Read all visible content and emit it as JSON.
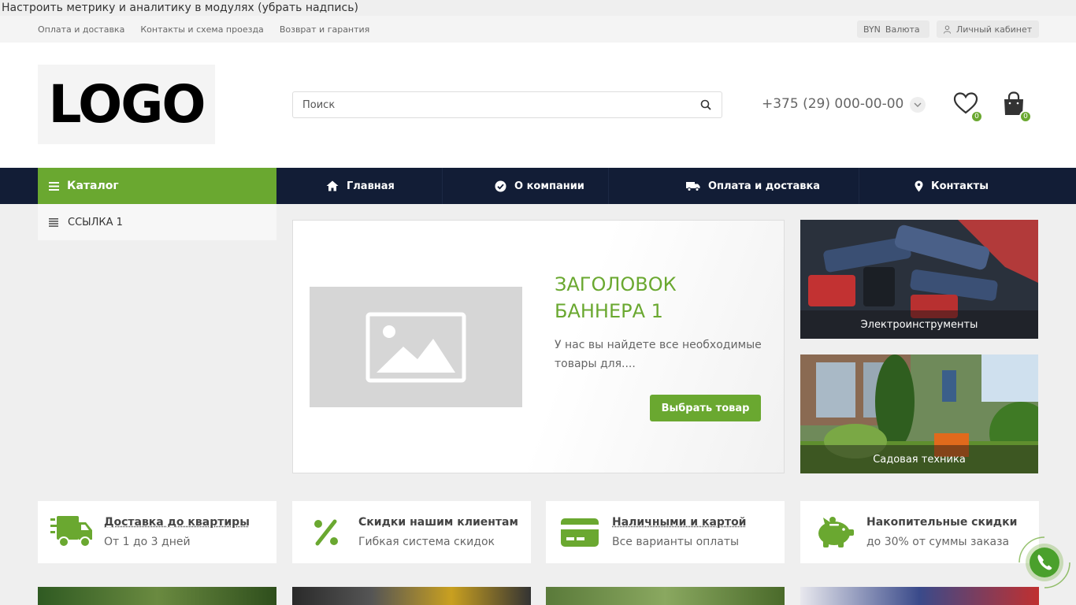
{
  "notice": "Настроить метрику и аналитику в модулях (убрать надпись)",
  "topbar": {
    "links": [
      "Оплата и доставка",
      "Контакты и схема проезда",
      "Возврат и гарантия"
    ],
    "currency_code": "BYN",
    "currency_label": "Валюта",
    "cabinet_label": "Личный кабинет"
  },
  "header": {
    "logo": "LOGO",
    "search_placeholder": "Поиск",
    "phone": "+375 (29) 000-00-00",
    "favorites_count": "0",
    "cart_count": "0"
  },
  "nav": {
    "catalog": "Каталог",
    "items": [
      "Главная",
      "О компании",
      "Оплата и доставка",
      "Контакты"
    ]
  },
  "catalog_menu": {
    "item": "ССЫЛКА 1"
  },
  "banner": {
    "title": "ЗАГОЛОВОК БАННЕРА 1",
    "text": "У нас вы найдете все необходимые товары для....",
    "button": "Выбрать товар"
  },
  "tiles": [
    "Электроинструменты",
    "Садовая техника"
  ],
  "features": [
    {
      "title": "Доставка до квартиры",
      "subtitle": "От 1 до 3 дней",
      "icon": "truck-icon"
    },
    {
      "title": "Скидки нашим клиентам",
      "subtitle": "Гибкая система скидок",
      "icon": "percent-icon"
    },
    {
      "title": "Наличными и картой",
      "subtitle": "Все варианты оплаты",
      "icon": "card-icon"
    },
    {
      "title": "Накопительные скидки",
      "subtitle": "до 30% от суммы заказа",
      "icon": "piggy-bank-icon"
    }
  ],
  "colors": {
    "accent": "#6aa830",
    "nav_bg": "#121d36"
  }
}
